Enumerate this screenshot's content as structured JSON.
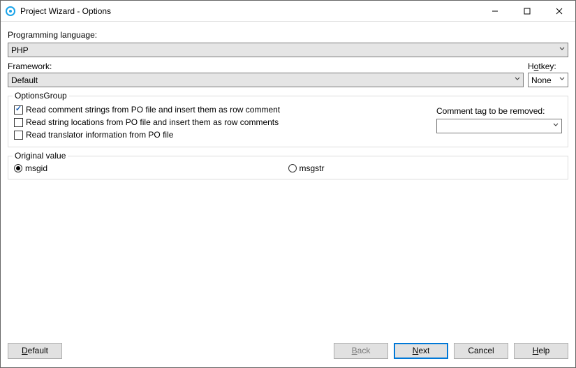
{
  "window": {
    "title": "Project Wizard - Options"
  },
  "programming_language": {
    "label": "Programming language:",
    "value": "PHP"
  },
  "framework": {
    "label": "Framework:",
    "value": "Default"
  },
  "hotkey": {
    "label_pre": "H",
    "label_u": "o",
    "label_post": "tkey:",
    "value": "None"
  },
  "options_group": {
    "title": "OptionsGroup",
    "opt1": {
      "checked": true,
      "label": "Read comment strings from PO file and insert them as row comment"
    },
    "opt2": {
      "checked": false,
      "label": "Read string locations from PO file and insert them as row comments"
    },
    "opt3": {
      "checked": false,
      "label": "Read translator information from PO file"
    },
    "comment_tag_label": "Comment tag to be removed:",
    "comment_tag_value": ""
  },
  "original_value": {
    "title": "Original value",
    "r1": {
      "selected": true,
      "label_u": "m",
      "label_post": "sgid"
    },
    "r2": {
      "selected": false,
      "label": "msgstr"
    }
  },
  "buttons": {
    "default": {
      "u": "D",
      "post": "efault"
    },
    "back": {
      "u": "B",
      "post": "ack"
    },
    "next": {
      "u": "N",
      "post": "ext"
    },
    "cancel": {
      "label": "Cancel"
    },
    "help": {
      "u": "H",
      "post": "elp"
    }
  }
}
